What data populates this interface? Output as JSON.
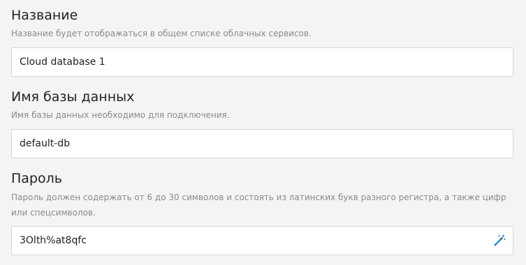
{
  "fields": {
    "name": {
      "label": "Название",
      "hint": "Название будет отображаться в общем списке облачных сервисов.",
      "value": "Cloud database 1"
    },
    "db_name": {
      "label": "Имя базы данных",
      "hint": "Имя базы данных необходимо для подключения.",
      "value": "default-db"
    },
    "password": {
      "label": "Пароль",
      "hint": "Пароль должен содержать от 6 до 30 символов и состоять из латинских букв разного регистра, а также цифр или спецсимволов.",
      "value": "3Olth%at8qfc",
      "generate_icon": "magic-wand-icon"
    }
  },
  "colors": {
    "background": "#f4f4f4",
    "input_border": "#d6d6d6",
    "hint_text": "#8a8a8a",
    "icon_accent": "#2b8fd6"
  }
}
